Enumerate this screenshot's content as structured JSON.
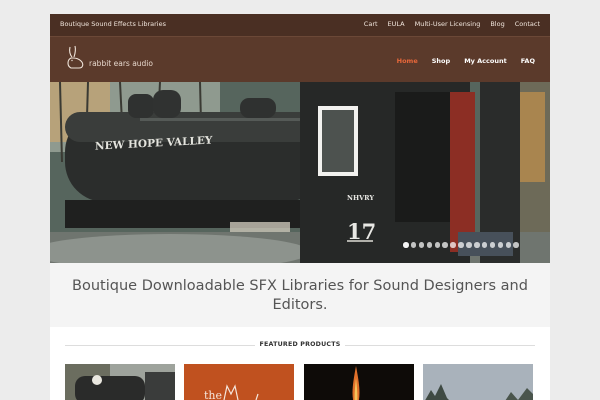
{
  "topbar": {
    "tagline": "Boutique Sound Effects Libraries",
    "links": [
      "Cart",
      "EULA",
      "Multi-User Licensing",
      "Blog",
      "Contact"
    ]
  },
  "logo": {
    "text": "rabbit ears audio",
    "icon": "rabbit-icon"
  },
  "nav": {
    "items": [
      "Home",
      "Shop",
      "My Account",
      "FAQ"
    ],
    "active": "Home"
  },
  "hero": {
    "locomotive_text": "NEW HOPE VALLEY",
    "cab_text": "NHVRY",
    "number_text": "17",
    "slide_count": 15,
    "active_slide": 1
  },
  "headline": "Boutique Downloadable SFX Libraries for Sound Designers and Editors.",
  "featured": {
    "title": "FEATURED PRODUCTS",
    "product_2_text": "the"
  },
  "colors": {
    "topbar": "#4a2f23",
    "header": "#5b3a2b",
    "accent": "#e8673a",
    "band": "#f4f4f4"
  }
}
